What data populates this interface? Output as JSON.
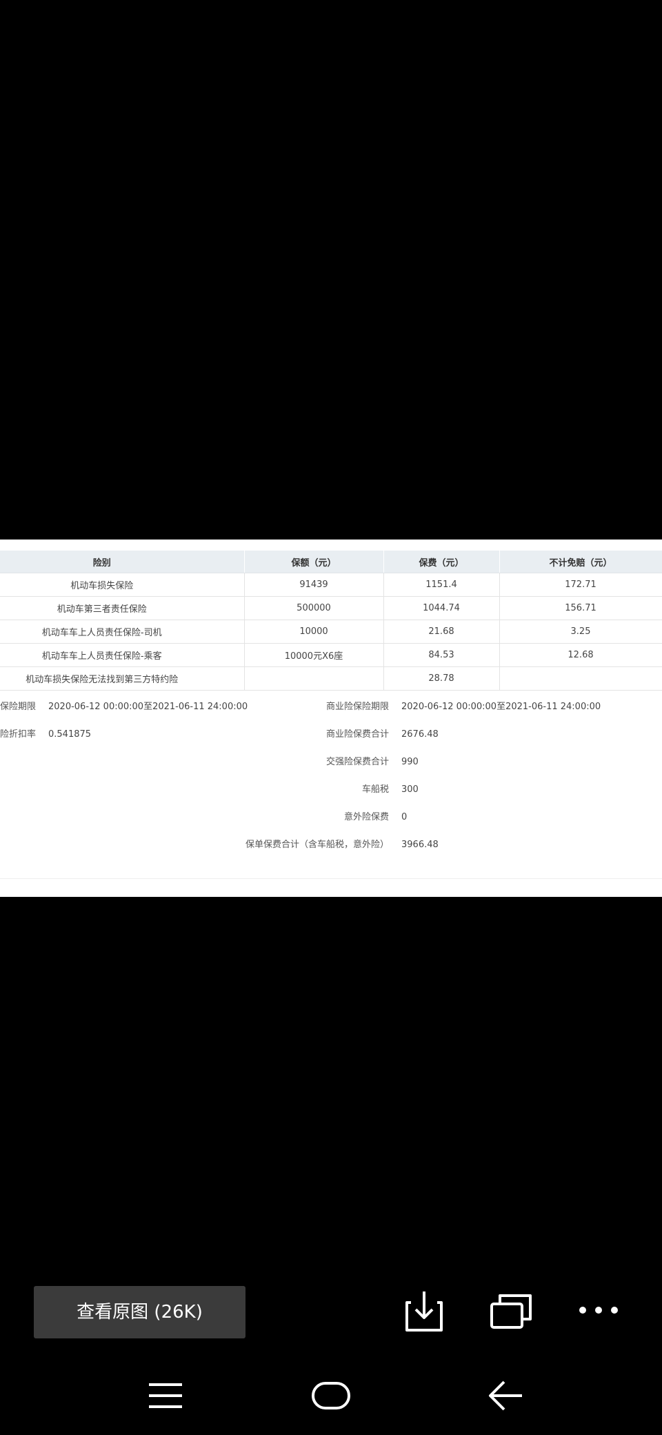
{
  "table": {
    "headers": [
      "险别",
      "保额（元）",
      "保费（元）",
      "不计免赔（元）"
    ],
    "rows": [
      [
        "机动车损失保险",
        "91439",
        "1151.4",
        "172.71"
      ],
      [
        "机动车第三者责任保险",
        "500000",
        "1044.74",
        "156.71"
      ],
      [
        "机动车车上人员责任保险-司机",
        "10000",
        "21.68",
        "3.25"
      ],
      [
        "机动车车上人员责任保险-乘客",
        "10000元X6座",
        "84.53",
        "12.68"
      ],
      [
        "机动车损失保险无法找到第三方特约险",
        "",
        "28.78",
        ""
      ]
    ]
  },
  "info_left": [
    {
      "label": "商业险保险期限",
      "value": "2020-06-12 00:00:00至2021-06-11 24:00:00"
    },
    {
      "label": "商业险折扣率",
      "value": "0.541875"
    }
  ],
  "info_right": [
    {
      "label": "商业险保险期限",
      "value": "2020-06-12 00:00:00至2021-06-11 24:00:00"
    },
    {
      "label": "商业险保费合计",
      "value": "2676.48"
    },
    {
      "label": "交强险保费合计",
      "value": "990"
    },
    {
      "label": "车船税",
      "value": "300"
    },
    {
      "label": "意外险保费",
      "value": "0"
    },
    {
      "label": "保单保费合计（含车船税，意外险）",
      "value": "3966.48"
    }
  ],
  "toolbar": {
    "view_original_label": "查看原图 (26K)"
  },
  "icons": {
    "download": "download-icon",
    "multiwindow": "multi-window-icon",
    "more": "more-icon",
    "menu": "menu-icon",
    "home": "home-icon",
    "back": "back-icon"
  },
  "colors": {
    "background": "#000000",
    "header_bg": "#e9eef2",
    "button_bg": "#3b3b3b"
  }
}
